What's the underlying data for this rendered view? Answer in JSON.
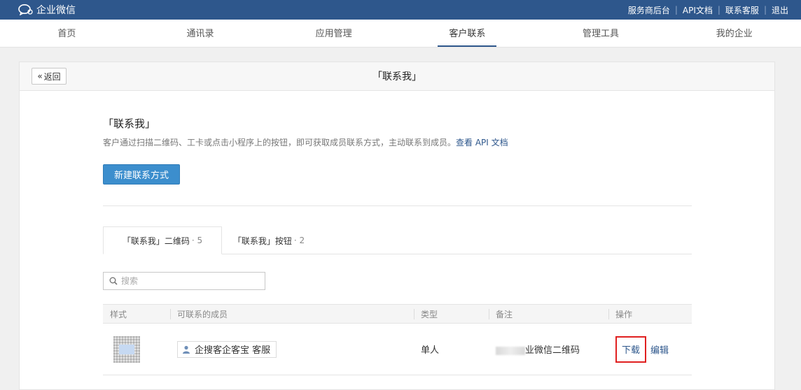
{
  "topbar": {
    "logo_text": "企业微信",
    "links": [
      "服务商后台",
      "API文档",
      "联系客服",
      "退出"
    ]
  },
  "nav": {
    "items": [
      "首页",
      "通讯录",
      "应用管理",
      "客户联系",
      "管理工具",
      "我的企业"
    ],
    "active_index": 3
  },
  "panel": {
    "back_label": "返回",
    "title": "「联系我」"
  },
  "intro": {
    "title": "「联系我」",
    "description": "客户通过扫描二维码、工卡或点击小程序上的按钮，即可获取成员联系方式，主动联系到成员。",
    "api_link": "查看 API 文档",
    "new_button": "新建联系方式"
  },
  "tabs": [
    {
      "label": "「联系我」二维码",
      "count": "· 5"
    },
    {
      "label": "「联系我」按钮",
      "count": "· 2"
    }
  ],
  "search": {
    "placeholder": "搜索"
  },
  "table": {
    "headers": [
      "样式",
      "可联系的成员",
      "类型",
      "备注",
      "操作"
    ],
    "rows": [
      {
        "member": "企搜客企客宝 客服",
        "type": "单人",
        "remark": "业微信二维码",
        "actions": [
          "下载",
          "编辑"
        ]
      }
    ]
  },
  "colors": {
    "topbar": "#2e578c",
    "primary_button": "#3c8ecd",
    "link": "#2e578c",
    "highlight": "#e02020"
  }
}
